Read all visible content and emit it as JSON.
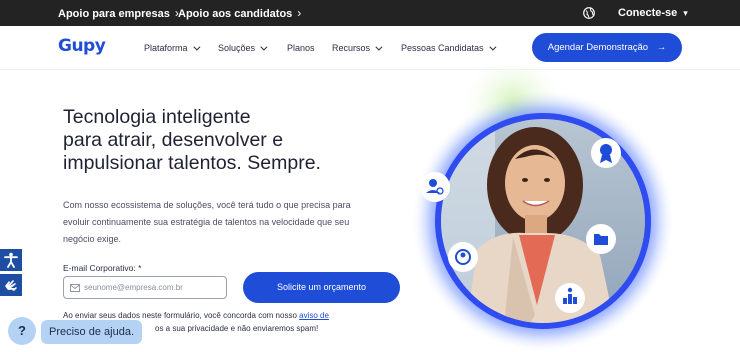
{
  "topbar": {
    "link_empresas": "Apoio para empresas",
    "link_candidatos": "Apoio aos candidatos",
    "conecte": "Conecte-se"
  },
  "brand": {
    "logo": "Gupy",
    "accent": "#1f4dd8"
  },
  "nav": {
    "items": [
      {
        "label": "Plataforma",
        "dropdown": true
      },
      {
        "label": "Soluções",
        "dropdown": true
      },
      {
        "label": "Planos",
        "dropdown": false
      },
      {
        "label": "Recursos",
        "dropdown": true
      },
      {
        "label": "Pessoas Candidatas",
        "dropdown": true
      }
    ],
    "demo_button": "Agendar Demonstração"
  },
  "hero": {
    "headline": [
      "Tecnologia inteligente",
      "para atrair, desenvolver e",
      "impulsionar talentos. Sempre."
    ],
    "subtext": "Com nosso ecossistema de soluções, você terá tudo o que precisa para evoluir continuamente sua estratégia de talentos na velocidade que seu negócio exige.",
    "form": {
      "email_label": "E-mail Corporativo: *",
      "email_placeholder": "seunome@empresa.com.br",
      "email_value": "",
      "submit": "Solicite um orçamento"
    },
    "consent_prefix": "Ao enviar seus dados neste formulário, você concorda com nosso ",
    "consent_link": "aviso de",
    "consent_suffix": "os a sua privacidade e não enviaremos spam!"
  },
  "help": {
    "icon_label": "?",
    "bubble": "Preciso de ajuda."
  },
  "icons": [
    "globe-icon",
    "chevron-right-icon",
    "chevron-down-icon",
    "arrow-right-icon",
    "mail-icon",
    "accessibility-icon",
    "sign-language-icon",
    "user-search-icon",
    "award-icon",
    "folder-icon",
    "ranking-icon",
    "profile-icon"
  ]
}
